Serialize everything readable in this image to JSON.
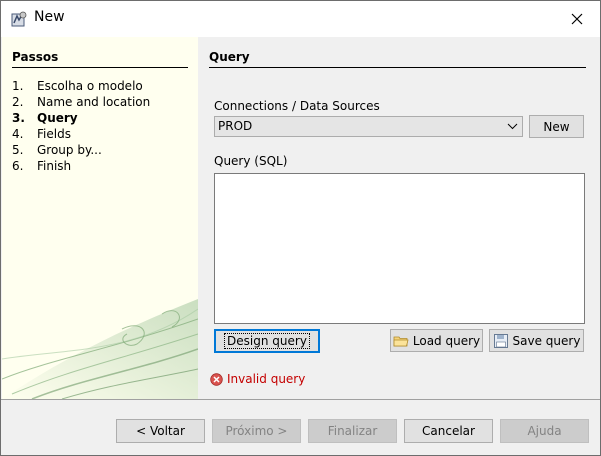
{
  "window": {
    "title": "New",
    "app_icon": "java-app-icon",
    "close_icon": "close-icon"
  },
  "steps": {
    "title": "Passos",
    "items": [
      {
        "num": "1.",
        "label": "Escolha o modelo"
      },
      {
        "num": "2.",
        "label": "Name and location"
      },
      {
        "num": "3.",
        "label": "Query"
      },
      {
        "num": "4.",
        "label": "Fields"
      },
      {
        "num": "5.",
        "label": "Group by..."
      },
      {
        "num": "6.",
        "label": "Finish"
      }
    ],
    "current_index": 2
  },
  "content": {
    "title": "Query",
    "connections_label": "Connections / Data Sources",
    "connection_value": "PROD",
    "new_button": "New",
    "query_label": "Query (SQL)",
    "query_value": "",
    "design_query_button": "Design query",
    "load_query_button": "Load query",
    "save_query_button": "Save query",
    "error_message": "Invalid query",
    "error_color": "#c40000"
  },
  "footer": {
    "back": "< Voltar",
    "next": "Próximo >",
    "finish": "Finalizar",
    "cancel": "Cancelar",
    "help": "Ajuda"
  }
}
